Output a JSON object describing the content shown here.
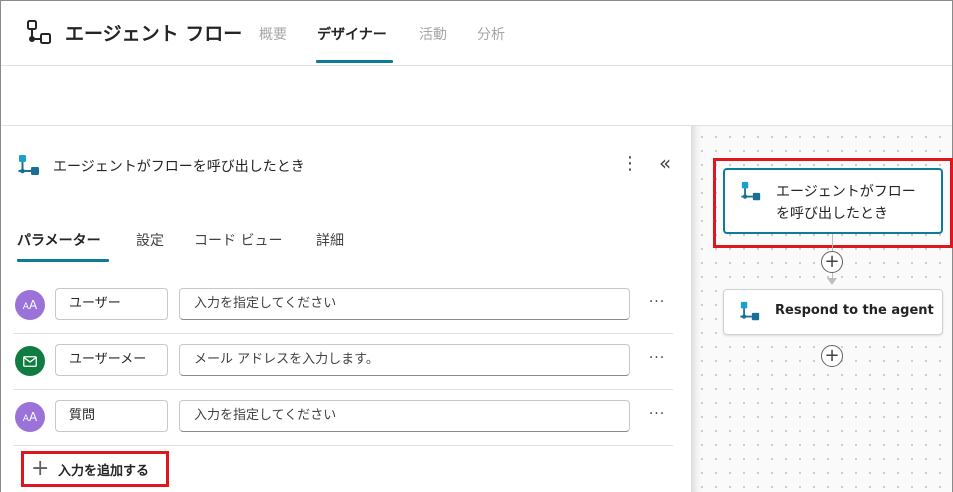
{
  "header": {
    "title": "エージェント フロー",
    "tabs": [
      {
        "label": "概要",
        "active": false
      },
      {
        "label": "デザイナー",
        "active": true
      },
      {
        "label": "活動",
        "active": false
      },
      {
        "label": "分析",
        "active": false
      }
    ]
  },
  "panel": {
    "title": "エージェントがフローを呼び出したとき",
    "tabs": [
      {
        "label": "パラメーター",
        "active": true
      },
      {
        "label": "設定",
        "active": false
      },
      {
        "label": "コード ビュー",
        "active": false
      },
      {
        "label": "詳細",
        "active": false
      }
    ],
    "inputs": [
      {
        "avatar_text": "AA",
        "avatar_color": "#9b72d9",
        "name": "ユーザー",
        "placeholder": "入力を指定してください"
      },
      {
        "avatar_text": "✉",
        "avatar_color": "#107c41",
        "name": "ユーザーメー",
        "placeholder": "メール アドレスを入力します。"
      },
      {
        "avatar_text": "AA",
        "avatar_color": "#9b72d9",
        "name": "質問",
        "placeholder": "入力を指定してください"
      }
    ],
    "add_input_label": "入力を追加する"
  },
  "canvas": {
    "trigger_node": {
      "line1": "エージェントがフロー",
      "line2": "を呼び出したとき"
    },
    "action_node": {
      "label": "Respond to the agent"
    }
  },
  "colors": {
    "accent": "#0f7b9a",
    "highlight": "#e0161f",
    "flow_icon": "#1ba1c9"
  }
}
